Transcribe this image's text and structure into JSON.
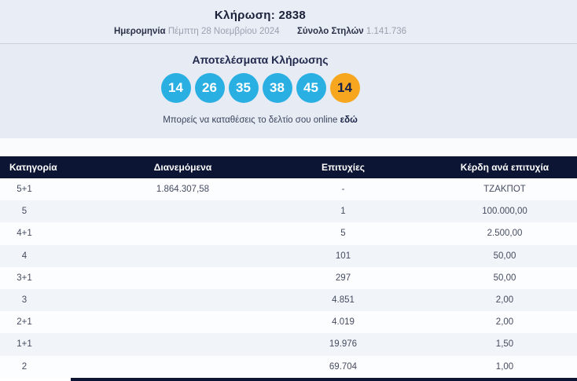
{
  "colors": {
    "ball_blue": "#2aafe3",
    "ball_orange": "#f6a71f",
    "navy": "#0c1634",
    "band_bg": "#e6ebf4"
  },
  "draw": {
    "title": "Κλήρωση: 2838",
    "date_label": "Ημερομηνία",
    "date_value": "Πέμπτη 28 Νοεμβρίου 2024",
    "columns_label": "Σύνολο Στηλών",
    "columns_value": "1.141.736"
  },
  "results": {
    "heading": "Αποτελέσματα Κλήρωσης",
    "numbers": [
      "14",
      "26",
      "35",
      "38",
      "45"
    ],
    "joker": "14",
    "caption_text": "Μπορείς να καταθέσεις το δελτίο σου online",
    "caption_link": "εδώ"
  },
  "table": {
    "headers": [
      "Κατηγορία",
      "Διανεμόμενα",
      "Επιτυχίες",
      "Κέρδη ανά επιτυχία"
    ],
    "rows": [
      {
        "category": "5+1",
        "distributed": "1.864.307,58",
        "winners": "-",
        "prize": "ΤΖΑΚΠΟΤ"
      },
      {
        "category": "5",
        "distributed": "",
        "winners": "1",
        "prize": "100.000,00"
      },
      {
        "category": "4+1",
        "distributed": "",
        "winners": "5",
        "prize": "2.500,00"
      },
      {
        "category": "4",
        "distributed": "",
        "winners": "101",
        "prize": "50,00"
      },
      {
        "category": "3+1",
        "distributed": "",
        "winners": "297",
        "prize": "50,00"
      },
      {
        "category": "3",
        "distributed": "",
        "winners": "4.851",
        "prize": "2,00"
      },
      {
        "category": "2+1",
        "distributed": "",
        "winners": "4.019",
        "prize": "2,00"
      },
      {
        "category": "1+1",
        "distributed": "",
        "winners": "19.976",
        "prize": "1,50"
      },
      {
        "category": "2",
        "distributed": "",
        "winners": "69.704",
        "prize": "1,00"
      }
    ]
  }
}
